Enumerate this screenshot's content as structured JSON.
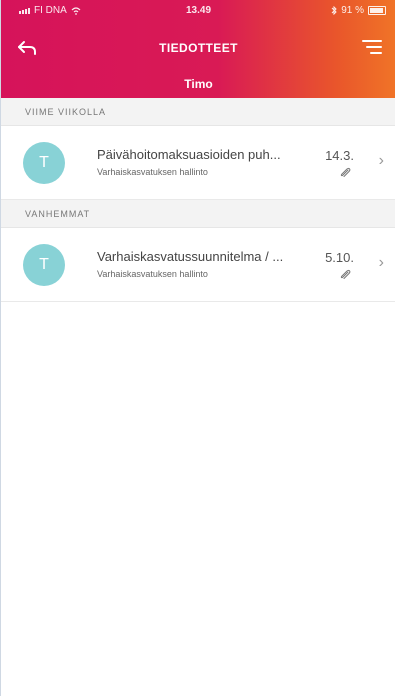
{
  "status_bar": {
    "carrier": "FI DNA",
    "time": "13.49",
    "battery": "91 %"
  },
  "header": {
    "title": "TIEDOTTEET",
    "subtitle": "Timo"
  },
  "sections": [
    {
      "label": "VIIME VIIKOLLA",
      "items": [
        {
          "avatar": "T",
          "title": "Päivähoitomaksuasioiden puh...",
          "sender": "Varhaiskasvatuksen hallinto",
          "date": "14.3.",
          "has_attachment": true
        }
      ]
    },
    {
      "label": "VANHEMMAT",
      "items": [
        {
          "avatar": "T",
          "title": "Varhaiskasvatussuunnitelma / ...",
          "sender": "Varhaiskasvatuksen hallinto",
          "date": "5.10.",
          "has_attachment": true
        }
      ]
    }
  ],
  "icons": {
    "back": "back-arrow-icon",
    "menu": "menu-icon",
    "attachment": "paperclip-icon",
    "chevron": "chevron-right-icon"
  },
  "colors": {
    "header_start": "#d6135a",
    "header_end": "#f07427",
    "avatar": "#88d2d6"
  }
}
